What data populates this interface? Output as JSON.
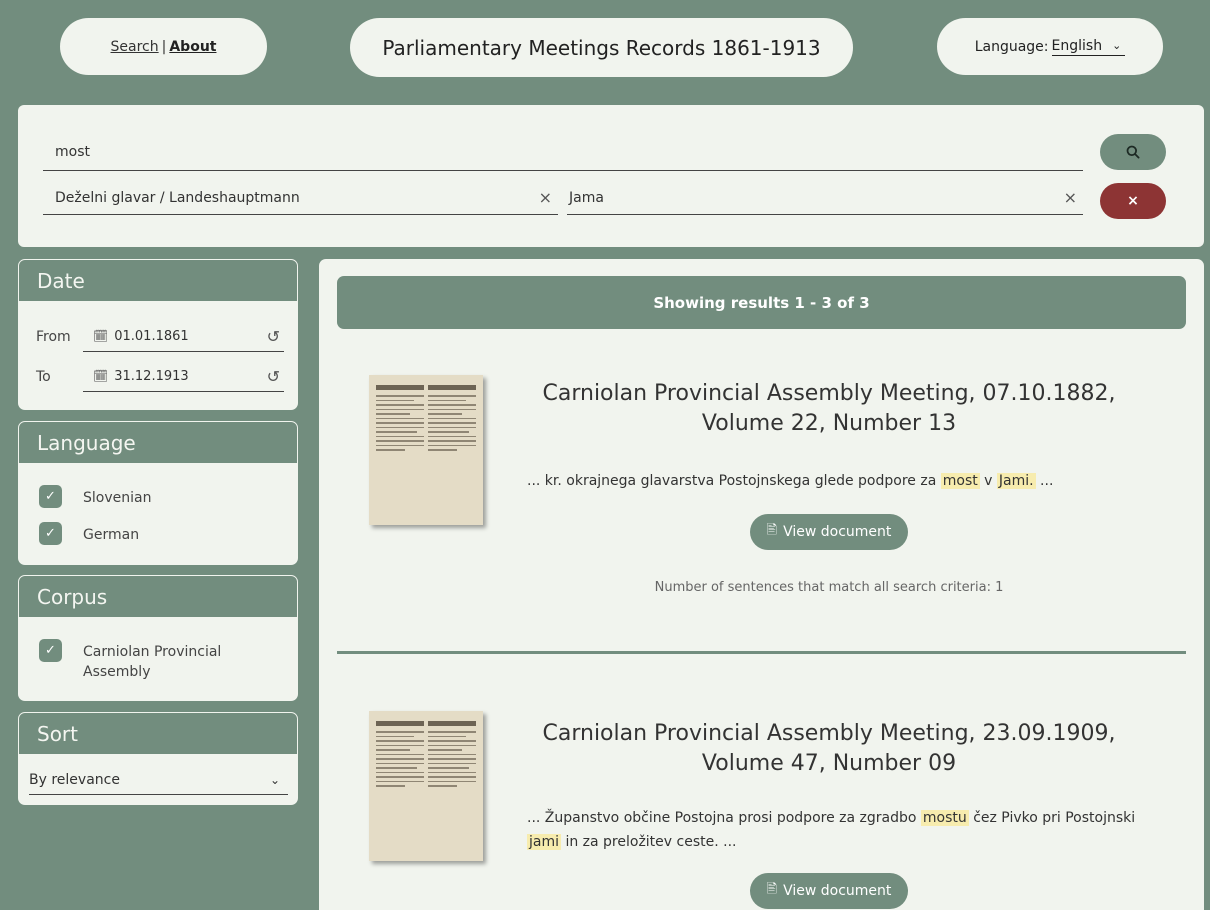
{
  "header": {
    "nav": {
      "search": "Search",
      "separator": "|",
      "about": "About"
    },
    "title": "Parliamentary Meetings Records 1861-1913",
    "language_label": "Language:",
    "language_value": "English"
  },
  "search": {
    "query": "most",
    "speaker": "Deželni glavar / Landeshauptmann",
    "place": "Jama",
    "clear_symbol": "×"
  },
  "filters": {
    "date": {
      "title": "Date",
      "from_label": "From",
      "from_value": "01.01.1861",
      "to_label": "To",
      "to_value": "31.12.1913"
    },
    "language": {
      "title": "Language",
      "options": [
        {
          "label": "Slovenian",
          "checked": true
        },
        {
          "label": "German",
          "checked": true
        }
      ]
    },
    "corpus": {
      "title": "Corpus",
      "options": [
        {
          "label": "Carniolan Provincial Assembly",
          "checked": true
        }
      ]
    },
    "sort": {
      "title": "Sort",
      "value": "By relevance"
    }
  },
  "results": {
    "summary": "Showing results 1 - 3 of 3",
    "items": [
      {
        "title": "Carniolan Provincial Assembly Meeting, 07.10.1882, Volume 22, Number 13",
        "snippet": {
          "pre": "... kr. okrajnega glavarstva Postojnskega glede podpore za ",
          "hl1": "most",
          "mid": " v ",
          "hl2": "Jami.",
          "post": " ..."
        },
        "button": "View document",
        "match_count": "Number of sentences that match all search criteria: 1"
      },
      {
        "title": "Carniolan Provincial Assembly Meeting, 23.09.1909, Volume 47, Number 09",
        "snippet": {
          "pre": "... Županstvo občine Postojna prosi podpore za zgradbo ",
          "hl1": "mostu",
          "mid": " čez Pivko pri Postojnski ",
          "hl2": "jami",
          "post": " in za preložitev ceste. ..."
        },
        "button": "View document"
      }
    ]
  }
}
